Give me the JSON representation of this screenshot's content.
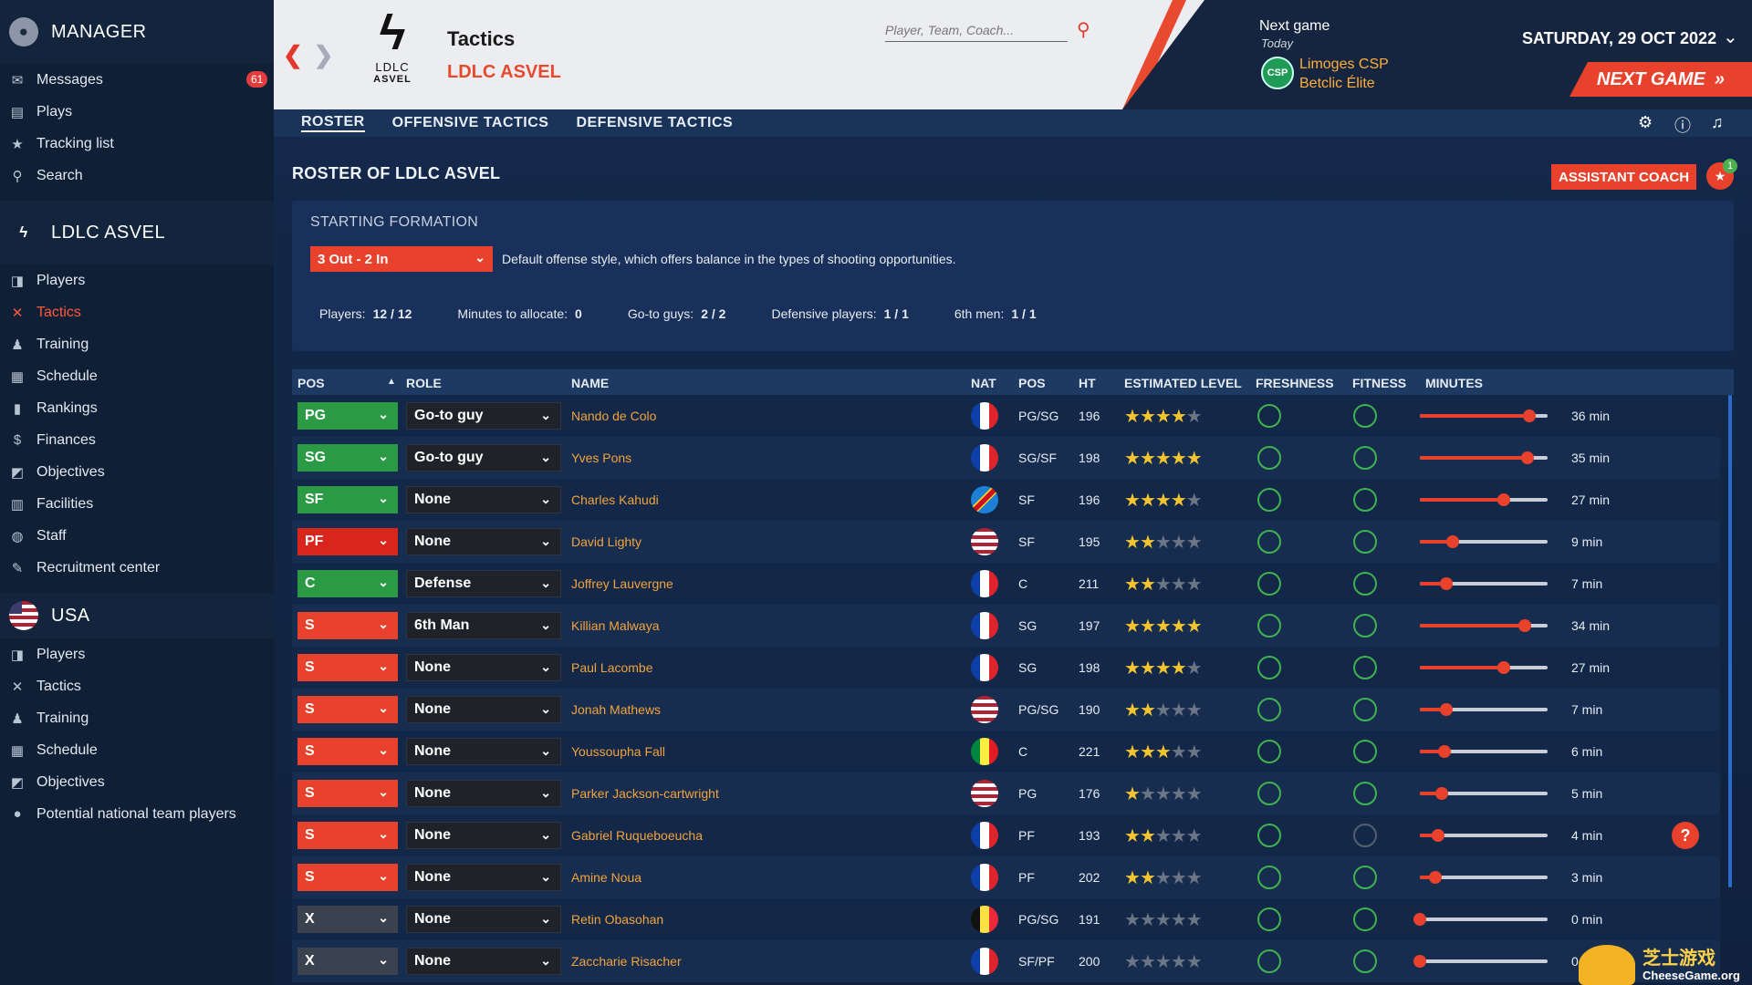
{
  "sidebar": {
    "manager_title": "MANAGER",
    "manager_items": [
      {
        "label": "Messages",
        "icon": "envelope-icon",
        "badge": "61"
      },
      {
        "label": "Plays",
        "icon": "document-icon"
      },
      {
        "label": "Tracking list",
        "icon": "star-icon"
      },
      {
        "label": "Search",
        "icon": "search-icon"
      }
    ],
    "club_title": "LDLC ASVEL",
    "club_items": [
      {
        "label": "Players",
        "icon": "players-icon"
      },
      {
        "label": "Tactics",
        "icon": "tactics-icon",
        "active": true
      },
      {
        "label": "Training",
        "icon": "training-icon"
      },
      {
        "label": "Schedule",
        "icon": "calendar-icon"
      },
      {
        "label": "Rankings",
        "icon": "rankings-icon"
      },
      {
        "label": "Finances",
        "icon": "finances-icon"
      },
      {
        "label": "Objectives",
        "icon": "objectives-icon"
      },
      {
        "label": "Facilities",
        "icon": "facilities-icon"
      },
      {
        "label": "Staff",
        "icon": "staff-icon"
      },
      {
        "label": "Recruitment center",
        "icon": "recruitment-icon"
      }
    ],
    "nation_title": "USA",
    "nation_items": [
      {
        "label": "Players",
        "icon": "players-icon"
      },
      {
        "label": "Tactics",
        "icon": "tactics-icon"
      },
      {
        "label": "Training",
        "icon": "training-icon"
      },
      {
        "label": "Schedule",
        "icon": "calendar-icon"
      },
      {
        "label": "Objectives",
        "icon": "objectives-icon"
      },
      {
        "label": "Potential national team players",
        "icon": "globe-icon"
      }
    ]
  },
  "header": {
    "logo_line1": "LDLC",
    "logo_line2": "ASVEL",
    "title": "Tactics",
    "subtitle": "LDLC ASVEL",
    "search_placeholder": "Player, Team, Coach...",
    "next_game_label": "Next game",
    "next_game_when": "Today",
    "opponent_logo": "CSP",
    "opponent": "Limoges CSP",
    "competition": "Betclic Élite",
    "date": "SATURDAY, 29 OCT 2022",
    "next_game_button": "NEXT GAME"
  },
  "tabs": [
    "ROSTER",
    "OFFENSIVE TACTICS",
    "DEFENSIVE TACTICS"
  ],
  "main": {
    "roster_title": "ROSTER OF LDLC ASVEL",
    "assistant_button": "ASSISTANT COACH",
    "assistant_badge": "1",
    "formation_label": "STARTING FORMATION",
    "formation_value": "3 Out - 2 In",
    "formation_desc": "Default offense style, which offers balance in the types of shooting opportunities.",
    "stats": [
      {
        "label": "Players:",
        "value": "12 / 12"
      },
      {
        "label": "Minutes to allocate:",
        "value": "0"
      },
      {
        "label": "Go-to guys:",
        "value": "2 / 2"
      },
      {
        "label": "Defensive players:",
        "value": "1 / 1"
      },
      {
        "label": "6th men:",
        "value": "1 / 1"
      }
    ]
  },
  "table": {
    "headers": {
      "pos": "POS",
      "role": "ROLE",
      "name": "NAME",
      "nat": "NAT",
      "pos2": "POS",
      "ht": "HT",
      "level": "ESTIMATED LEVEL",
      "freshness": "FRESHNESS",
      "fitness": "FITNESS",
      "minutes": "MINUTES"
    },
    "rows": [
      {
        "slot": "PG",
        "slot_color": "#2a9a44",
        "role": "Go-to guy",
        "name": "Nando de Colo",
        "nat": "fr",
        "pos": "PG/SG",
        "ht": "196",
        "stars": 4,
        "fit_ok": true,
        "min_frac": 0.86,
        "minutes": "36 min"
      },
      {
        "slot": "SG",
        "slot_color": "#2a9a44",
        "role": "Go-to guy",
        "name": "Yves Pons",
        "nat": "fr",
        "pos": "SG/SF",
        "ht": "198",
        "stars": 5,
        "fit_ok": true,
        "min_frac": 0.84,
        "minutes": "35 min"
      },
      {
        "slot": "SF",
        "slot_color": "#2a9a44",
        "role": "None",
        "name": "Charles Kahudi",
        "nat": "cd",
        "pos": "SF",
        "ht": "196",
        "stars": 3.5,
        "fit_ok": true,
        "min_frac": 0.66,
        "minutes": "27 min"
      },
      {
        "slot": "PF",
        "slot_color": "#d9261c",
        "role": "None",
        "name": "David Lighty",
        "nat": "us",
        "pos": "SF",
        "ht": "195",
        "stars": 1.5,
        "fit_ok": true,
        "min_frac": 0.26,
        "minutes": "9 min"
      },
      {
        "slot": "C",
        "slot_color": "#2a9a44",
        "role": "Defense",
        "name": "Joffrey Lauvergne",
        "nat": "fr",
        "pos": "C",
        "ht": "211",
        "stars": 2,
        "fit_ok": true,
        "min_frac": 0.21,
        "minutes": "7 min"
      },
      {
        "slot": "S",
        "slot_color": "#e8412c",
        "role": "6th Man",
        "name": "Killian Malwaya",
        "nat": "fr",
        "pos": "SG",
        "ht": "197",
        "stars": 5,
        "fit_ok": true,
        "min_frac": 0.82,
        "minutes": "34 min"
      },
      {
        "slot": "S",
        "slot_color": "#e8412c",
        "role": "None",
        "name": "Paul Lacombe",
        "nat": "fr",
        "pos": "SG",
        "ht": "198",
        "stars": 3.5,
        "fit_ok": true,
        "min_frac": 0.66,
        "minutes": "27 min"
      },
      {
        "slot": "S",
        "slot_color": "#e8412c",
        "role": "None",
        "name": "Jonah Mathews",
        "nat": "us",
        "pos": "PG/SG",
        "ht": "190",
        "stars": 1.5,
        "fit_ok": true,
        "min_frac": 0.21,
        "minutes": "7 min"
      },
      {
        "slot": "S",
        "slot_color": "#e8412c",
        "role": "None",
        "name": "Youssoupha Fall",
        "nat": "sn",
        "pos": "C",
        "ht": "221",
        "stars": 3,
        "fit_ok": true,
        "min_frac": 0.19,
        "minutes": "6 min"
      },
      {
        "slot": "S",
        "slot_color": "#e8412c",
        "role": "None",
        "name": "Parker Jackson-cartwright",
        "nat": "us",
        "pos": "PG",
        "ht": "176",
        "stars": 1,
        "fit_ok": true,
        "min_frac": 0.17,
        "minutes": "5 min"
      },
      {
        "slot": "S",
        "slot_color": "#e8412c",
        "role": "None",
        "name": "Gabriel Ruqueboeucha",
        "nat": "fr",
        "pos": "PF",
        "ht": "193",
        "stars": 2,
        "fit_ok": false,
        "min_frac": 0.14,
        "minutes": "4 min",
        "help": "?"
      },
      {
        "slot": "S",
        "slot_color": "#e8412c",
        "role": "None",
        "name": "Amine Noua",
        "nat": "fr",
        "pos": "PF",
        "ht": "202",
        "stars": 2,
        "fit_ok": true,
        "min_frac": 0.12,
        "minutes": "3 min"
      },
      {
        "slot": "X",
        "slot_color": "#3a4250",
        "role": "None",
        "name": "Retin Obasohan",
        "nat": "be",
        "pos": "PG/SG",
        "ht": "191",
        "stars": 0,
        "fit_ok": true,
        "min_frac": 0.0,
        "minutes": "0 min"
      },
      {
        "slot": "X",
        "slot_color": "#3a4250",
        "role": "None",
        "name": "Zaccharie Risacher",
        "nat": "fr",
        "pos": "SF/PF",
        "ht": "200",
        "stars": 0,
        "fit_ok": true,
        "min_frac": 0.0,
        "minutes": "0 min"
      }
    ]
  },
  "watermark": {
    "text": "芝士游戏",
    "sub": "CheeseGame.org"
  }
}
